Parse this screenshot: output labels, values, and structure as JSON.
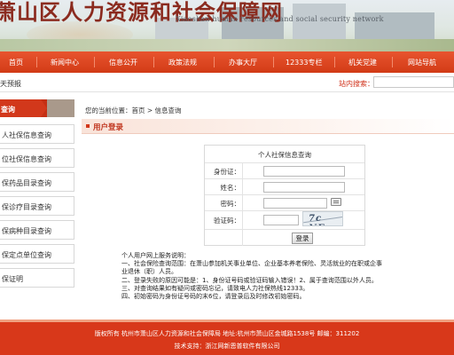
{
  "banner": {
    "title_cn": "萧山区人力资源和社会保障网",
    "title_en": "Xiaoshan human resources and social security network"
  },
  "nav": {
    "items": [
      "首页",
      "新闻中心",
      "信息公开",
      "政策法规",
      "办事大厅",
      "12333专栏",
      "机关党建",
      "网站导航"
    ]
  },
  "subbar": {
    "left_text": "天预报",
    "search_label": "站内搜索："
  },
  "sidebar": {
    "header": "查询",
    "items": [
      "人社保信息查询",
      "位社保信息查询",
      "保药品目录查询",
      "保诊疗目录查询",
      "保病种目录查询",
      "保定点单位查询",
      "保证明"
    ]
  },
  "main": {
    "breadcrumb": "您的当前位置：首页 > 信息查询",
    "section_title": "用户登录",
    "form": {
      "title": "个人社保信息查询",
      "id_label": "身份证：",
      "name_label": "姓名：",
      "password_label": "密码：",
      "captcha_label": "验证码：",
      "captcha_text": "7c NE",
      "submit_label": "登录"
    },
    "notes": [
      "个人用户网上服务说明：",
      "一、社会保险查询范围：在萧山参加机关事业单位、企业基本养老保险、灵活就业的在职或企事业退休（职）人员。",
      "二、登录失败的原因可能是：1、身份证号码或验证码输入错误！2、属于查询范围以外人员。",
      "三、对查询结果如有疑问或密码忘记，请致电人力社保热线12333。",
      "四、初始密码为身份证号码的末6位，请登录后及时修改初始密码。"
    ]
  },
  "footer": {
    "line1": "版权所有  杭州市萧山区人力资源和社会保障局  地址:杭州市萧山区金城路1538号   邮编：311202",
    "line2": "技术支持：浙江网新恩普软件有限公司"
  }
}
